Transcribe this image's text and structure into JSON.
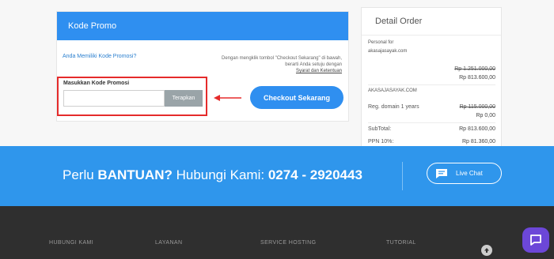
{
  "promo": {
    "header": "Kode Promo",
    "question_link": "Anda Memiliki Kode Promosi?",
    "note_line1": "Dengan mengklik tombol \"Checkout Sekarang\" di bawah,",
    "note_line2": "berarti Anda setuju dengan",
    "terms_link": "Syarat dan Ketentuan",
    "input_label": "Masukkan Kode Promosi",
    "input_value": "",
    "apply_label": "Terapkan",
    "checkout_label": "Checkout Sekarang",
    "highlight_color": "#e52b2b"
  },
  "detail": {
    "title": "Detail Order",
    "personal_for": "Personal for",
    "domain1": "akasajasayak.com",
    "old_price1": "Rp 1.251.000,00",
    "new_price1": "Rp 813.600,00",
    "domain2": "AKASAJASAYAK.COM",
    "reg_label": "Reg. domain 1 years",
    "old_price2": "Rp 115.000,00",
    "new_price2": "Rp 0,00",
    "subtotal_label": "SubTotal:",
    "subtotal_value": "Rp 813.600,00",
    "ppn_label": "PPN 10%:",
    "ppn_value": "Rp 81.360,00"
  },
  "banner": {
    "text_pre": "Perlu ",
    "text_bold": "BANTUAN?",
    "text_mid": " Hubungi Kami: ",
    "phone": "0274 - 2920443",
    "live_chat": "Live Chat",
    "bg_color": "#2f96ec"
  },
  "footer": {
    "col1": "HUBUNGI KAMI",
    "col2": "LAYANAN",
    "col3": "SERVICE HOSTING",
    "col4": "TUTORIAL"
  },
  "icons": {
    "chat": "chat-bubble-icon",
    "scroll_top": "arrow-up-icon",
    "chat_fab": "chat-widget-icon"
  }
}
